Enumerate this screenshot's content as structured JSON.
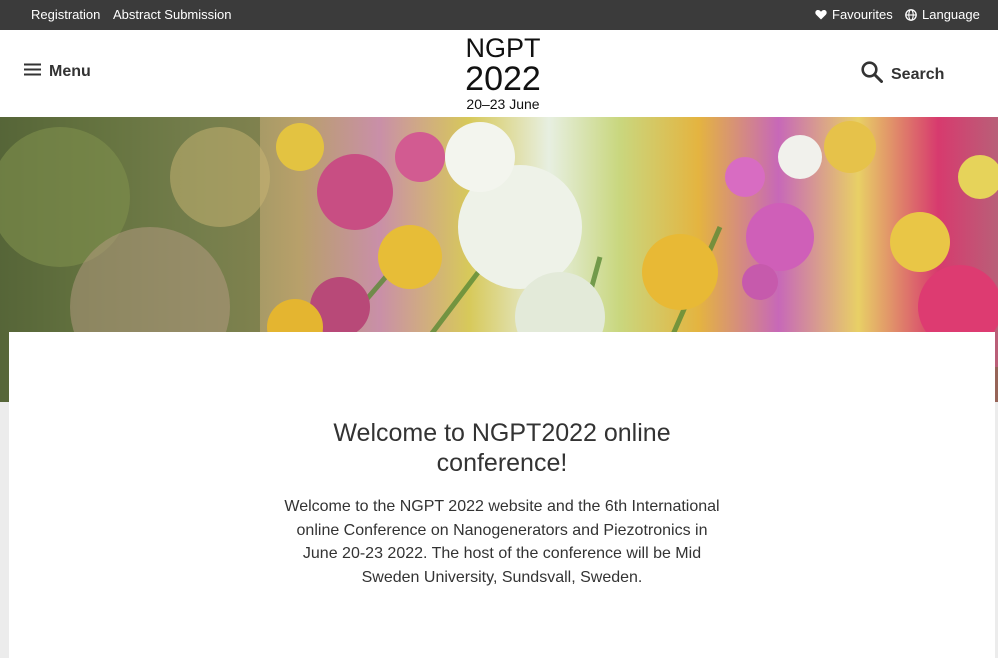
{
  "topbar": {
    "registration": "Registration",
    "abstract_submission": "Abstract Submission",
    "favourites": "Favourites",
    "language": "Language",
    "favourites_icon": "heart-icon",
    "language_icon": "globe-icon"
  },
  "header": {
    "menu_label": "Menu",
    "menu_icon": "hamburger-icon",
    "search_label": "Search",
    "search_icon": "search-icon",
    "logo": {
      "line1": "NGPT",
      "line2": "2022",
      "line3": "20–23 June"
    }
  },
  "hero": {
    "image": "wildflower-bouquet"
  },
  "main": {
    "title": "Welcome to NGPT2022 online conference!",
    "body": "Welcome to the NGPT 2022 website and the 6th International online Conference on Nanogenerators and Piezotronics in June 20-23 2022. The host of the conference will be Mid Sweden University, Sundsvall, Sweden."
  },
  "colors": {
    "topbar_bg": "#3b3b3b",
    "header_bg": "#ffffff",
    "page_bg": "#ececec",
    "text": "#333333"
  }
}
